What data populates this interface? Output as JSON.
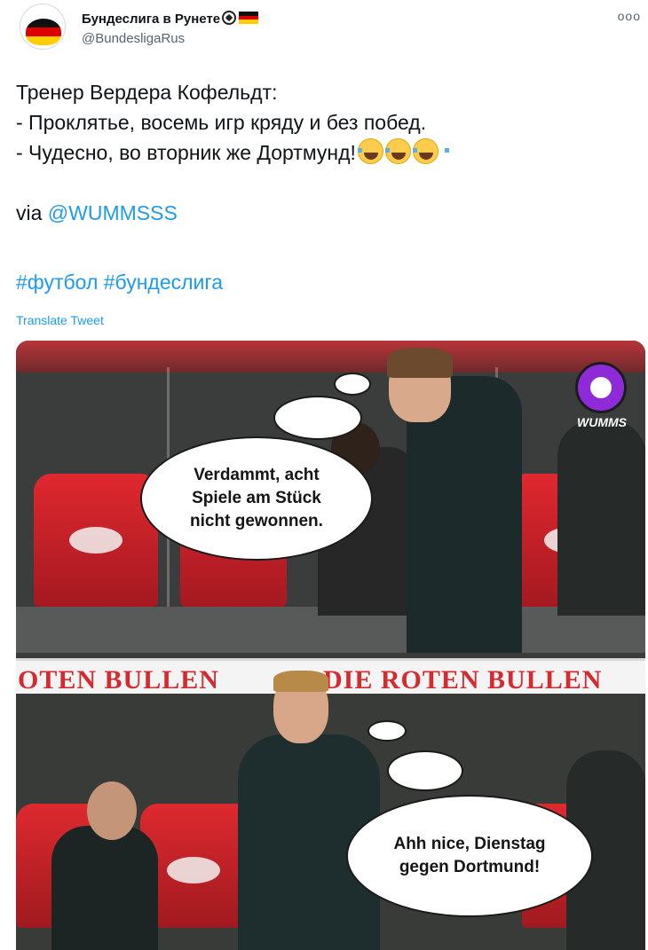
{
  "tweet": {
    "author_name": "Бундеслига в Рунете",
    "author_handle": "@BundesligaRus",
    "more_label": "ooo",
    "lines": {
      "line1": "Тренер Вердера Кофельдт:",
      "line2": "- Проклятье, восемь игр кряду и без побед.",
      "line3": "- Чудесно, во вторник же Дортмунд!",
      "via_prefix": "via ",
      "via_link": "@WUMMSSS",
      "hashtag1": "#футбол",
      "hashtag2": "#бундеслига"
    },
    "translate_label": "Translate Tweet",
    "emojis": [
      "face-with-tears-of-joy",
      "face-with-tears-of-joy",
      "face-with-tears-of-joy"
    ]
  },
  "media": {
    "watermark": "WUMMS",
    "top_bubble": [
      "Verdammt, acht",
      "Spiele am Stück",
      "nicht gewonnen."
    ],
    "bottom_bubble": [
      "Ahh nice, Dienstag",
      "gegen Dortmund!"
    ],
    "banner_left": "OTEN BULLEN",
    "banner_right": "DIE ROTEN BULLEN",
    "seat_logo_text": "DIE ROTEN BULLEN"
  },
  "colors": {
    "link": "#1d9bf0",
    "text": "#0f1419",
    "secondary": "#536471",
    "seat_red": "#e0282f",
    "wumms_purple": "#8e2ad8"
  }
}
